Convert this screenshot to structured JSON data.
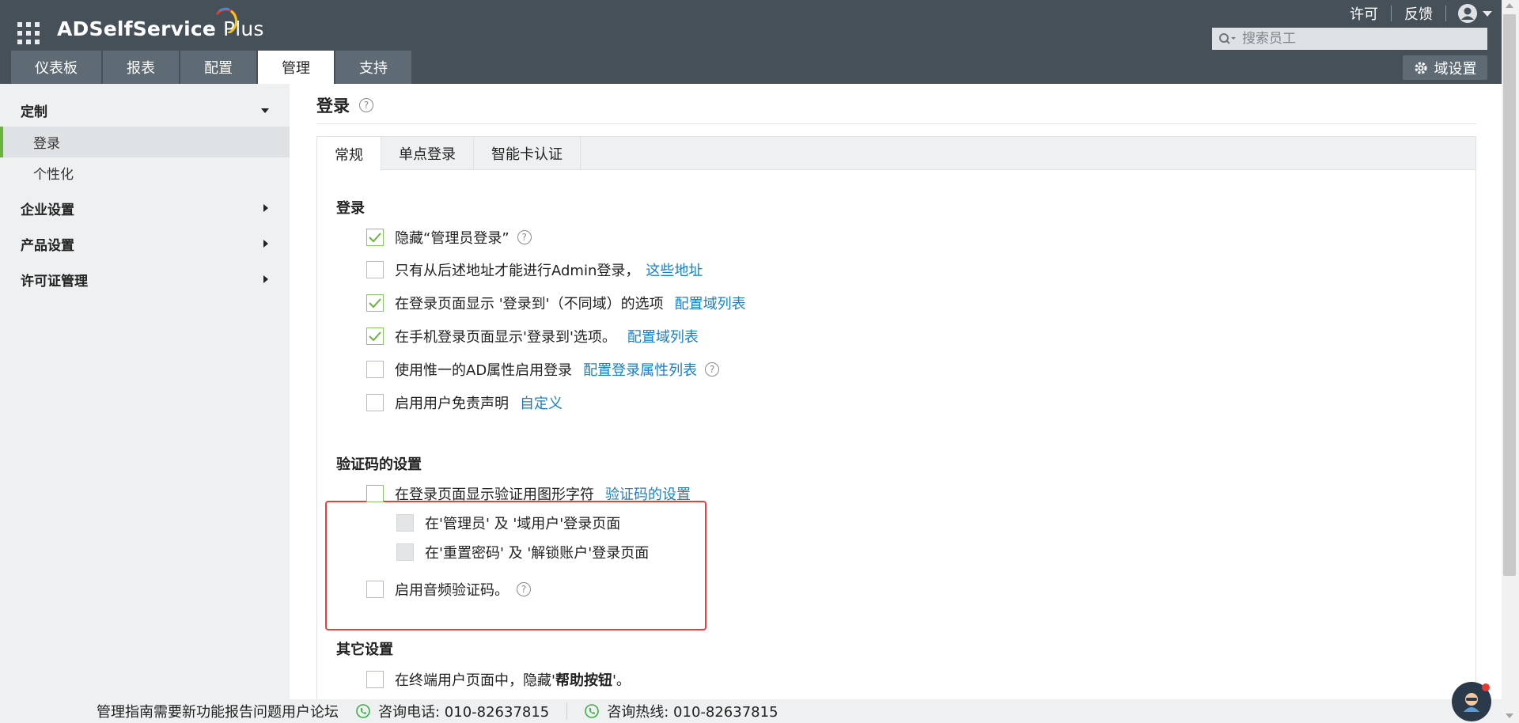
{
  "app": {
    "logo_text": "ADSelfService",
    "logo_plus": "Plus"
  },
  "header": {
    "links": [
      "许可",
      "反馈"
    ],
    "search_placeholder": "搜索员工",
    "nav_tabs": [
      "仪表板",
      "报表",
      "配置",
      "管理",
      "支持"
    ],
    "active_tab": "管理",
    "domain_button": "域设置"
  },
  "sidebar": {
    "sections": [
      {
        "label": "定制",
        "expanded": true,
        "items": [
          "登录",
          "个性化"
        ],
        "active_item": "登录"
      },
      {
        "label": "企业设置",
        "expanded": false
      },
      {
        "label": "产品设置",
        "expanded": false
      },
      {
        "label": "许可证管理",
        "expanded": false
      }
    ]
  },
  "main": {
    "title": "登录",
    "sub_tabs": [
      "常规",
      "单点登录",
      "智能卡认证"
    ],
    "active_sub_tab": "常规",
    "login_section": {
      "heading": "登录",
      "options": [
        {
          "label": "隐藏“管理员登录”",
          "checked": true
        },
        {
          "label": "只有从后述地址才能进行Admin登录，",
          "checked": false,
          "link": "这些地址"
        },
        {
          "label": "在登录页面显示 '登录到'（不同域）的选项",
          "checked": true,
          "link": "配置域列表"
        },
        {
          "label": "在手机登录页面显示'登录到'选项。",
          "checked": true,
          "link": "配置域列表"
        },
        {
          "label": "使用惟一的AD属性启用登录",
          "checked": false,
          "link": "配置登录属性列表"
        },
        {
          "label": "启用用户免责声明",
          "checked": false,
          "link": "自定义"
        }
      ]
    },
    "captcha_section": {
      "heading": "验证码的设置",
      "main_option": {
        "label": "在登录页面显示验证用图形字符",
        "checked": false,
        "link": "验证码的设置"
      },
      "sub_options": [
        {
          "label": "在'管理员' 及 '域用户'登录页面",
          "disabled": true
        },
        {
          "label": "在'重置密码' 及 '解锁账户'登录页面",
          "disabled": true
        }
      ],
      "audio_option": {
        "label": "启用音频验证码。",
        "checked": false
      }
    },
    "other_section": {
      "heading": "其它设置",
      "option_prefix": "在终端用户页面中，隐藏'",
      "option_bold": "帮助按钮",
      "option_suffix": "'。"
    }
  },
  "footer": {
    "guide_text": "管理指南需要新功能报告问题用户论坛",
    "phone_label": "咨询电话: 010-82637815",
    "hotline_label": "咨询热线: 010-82637815"
  },
  "colors": {
    "header_bg": "#455059",
    "tab_bg": "#5f6b74",
    "sidebar_bg": "#eef0f1",
    "active_accent": "#6cb33e",
    "link": "#1b7fc6",
    "highlight_box": "#e8413c"
  }
}
